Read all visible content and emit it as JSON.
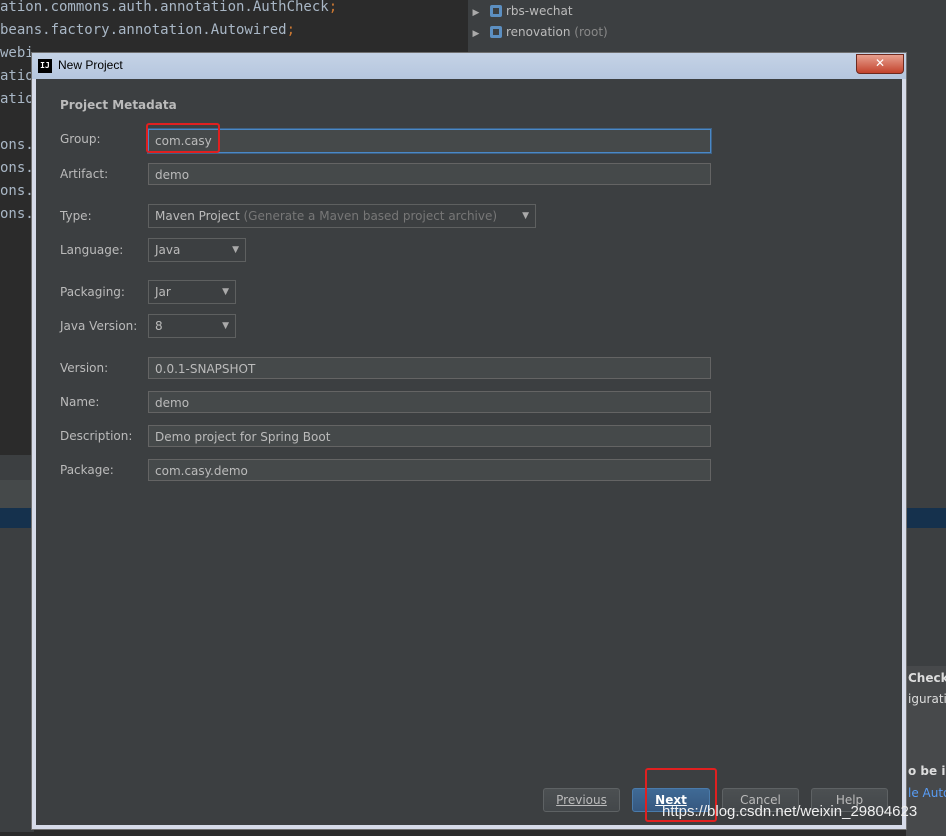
{
  "ide": {
    "code_lines": [
      "ation.commons.auth.annotation.AuthCheck",
      "beans.factory.annotation.Autowired",
      "webi",
      "atio",
      "atio",
      "",
      "ons.",
      "ons.",
      "ons.",
      "ons."
    ],
    "semicolon": ";",
    "project_tree": [
      {
        "name": "rbs-wechat",
        "suffix": ""
      },
      {
        "name": "renovation",
        "suffix": "(root)"
      }
    ],
    "notification": {
      "title": "Check",
      "line1": "igurati",
      "line2": "o be i",
      "link": "le Auto"
    }
  },
  "dialog": {
    "app_icon": "IJ",
    "title": "New Project",
    "close_glyph": "✕",
    "section_title": "Project Metadata",
    "fields": {
      "group": {
        "label": "Group:",
        "value": "com.casy"
      },
      "artifact": {
        "label": "Artifact:",
        "value": "demo"
      },
      "type": {
        "label": "Type:",
        "value": "Maven Project",
        "hint": "(Generate a Maven based project archive)"
      },
      "language": {
        "label": "Language:",
        "value": "Java"
      },
      "packaging": {
        "label": "Packaging:",
        "value": "Jar"
      },
      "java_version": {
        "label": "Java Version:",
        "value": "8"
      },
      "version": {
        "label": "Version:",
        "value": "0.0.1-SNAPSHOT"
      },
      "name": {
        "label": "Name:",
        "value": "demo"
      },
      "description": {
        "label": "Description:",
        "value": "Demo project for Spring Boot"
      },
      "package": {
        "label": "Package:",
        "value": "com.casy.demo"
      }
    },
    "buttons": {
      "previous": "Previous",
      "next": "Next",
      "cancel": "Cancel",
      "help": "Help"
    }
  },
  "watermark": "https://blog.csdn.net/weixin_29804623",
  "colors": {
    "dialog_bg": "#3c3f41",
    "editor_bg": "#2b2b2b",
    "focus_border": "#4a88c7",
    "highlight_red": "#e02020",
    "primary_button": "#365880"
  }
}
